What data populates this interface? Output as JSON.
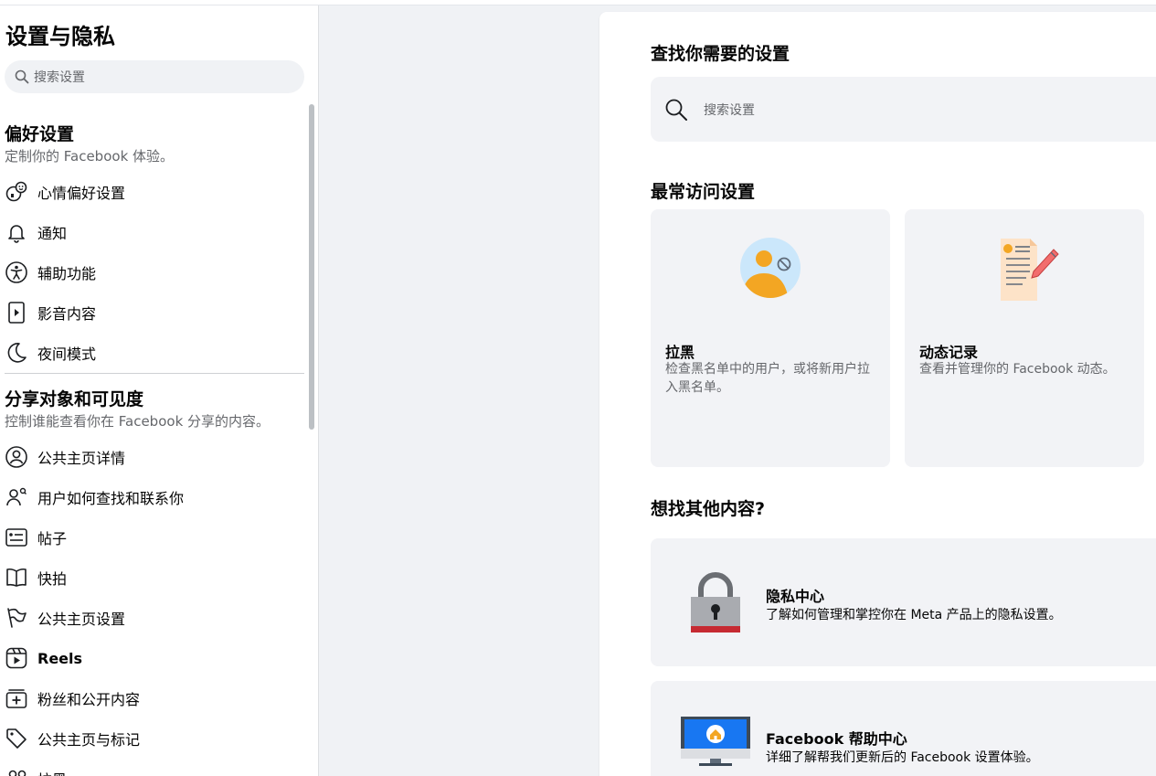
{
  "sidebar": {
    "title": "设置与隐私",
    "search_placeholder": "搜索设置",
    "preferences": {
      "heading": "偏好设置",
      "subtitle": "定制你的 Facebook 体验。",
      "items": [
        {
          "label": "心情偏好设置",
          "icon": "reactions-icon"
        },
        {
          "label": "通知",
          "icon": "bell-icon"
        },
        {
          "label": "辅助功能",
          "icon": "accessibility-icon"
        },
        {
          "label": "影音内容",
          "icon": "media-icon"
        },
        {
          "label": "夜间模式",
          "icon": "moon-icon"
        }
      ]
    },
    "audience": {
      "heading": "分享对象和可见度",
      "subtitle": "控制谁能查看你在 Facebook 分享的内容。",
      "items": [
        {
          "label": "公共主页详情",
          "icon": "user-circle-icon"
        },
        {
          "label": "用户如何查找和联系你",
          "icon": "people-search-icon"
        },
        {
          "label": "帖子",
          "icon": "post-icon"
        },
        {
          "label": "快拍",
          "icon": "book-icon"
        },
        {
          "label": "公共主页设置",
          "icon": "flag-icon"
        },
        {
          "label": "Reels",
          "icon": "reels-icon"
        },
        {
          "label": "粉丝和公开内容",
          "icon": "add-box-icon"
        },
        {
          "label": "公共主页与标记",
          "icon": "tag-icon"
        },
        {
          "label": "拉黑",
          "icon": "block-user-icon"
        }
      ]
    }
  },
  "main": {
    "find_heading": "查找你需要的设置",
    "search_placeholder": "搜索设置",
    "frequent_heading": "最常访问设置",
    "cards": [
      {
        "title": "拉黑",
        "desc": "检查黑名单中的用户，或将新用户拉入黑名单。",
        "icon": "block-illustration-icon"
      },
      {
        "title": "动态记录",
        "desc": "查看并管理你的 Facebook 动态。",
        "icon": "activity-log-illustration-icon"
      }
    ],
    "other_heading": "想找其他内容?",
    "links": [
      {
        "title": "隐私中心",
        "desc": "了解如何管理和掌控你在 Meta 产品上的隐私设置。",
        "icon": "padlock-illustration-icon"
      },
      {
        "title": "Facebook 帮助中心",
        "desc": "详细了解帮我们更新后的 Facebook 设置体验。",
        "icon": "monitor-illustration-icon"
      }
    ]
  },
  "colors": {
    "accent_blue": "#1877f2",
    "block_orange": "#f3a623",
    "block_blue": "#cbe7fb",
    "lock_red": "#c62a32"
  }
}
